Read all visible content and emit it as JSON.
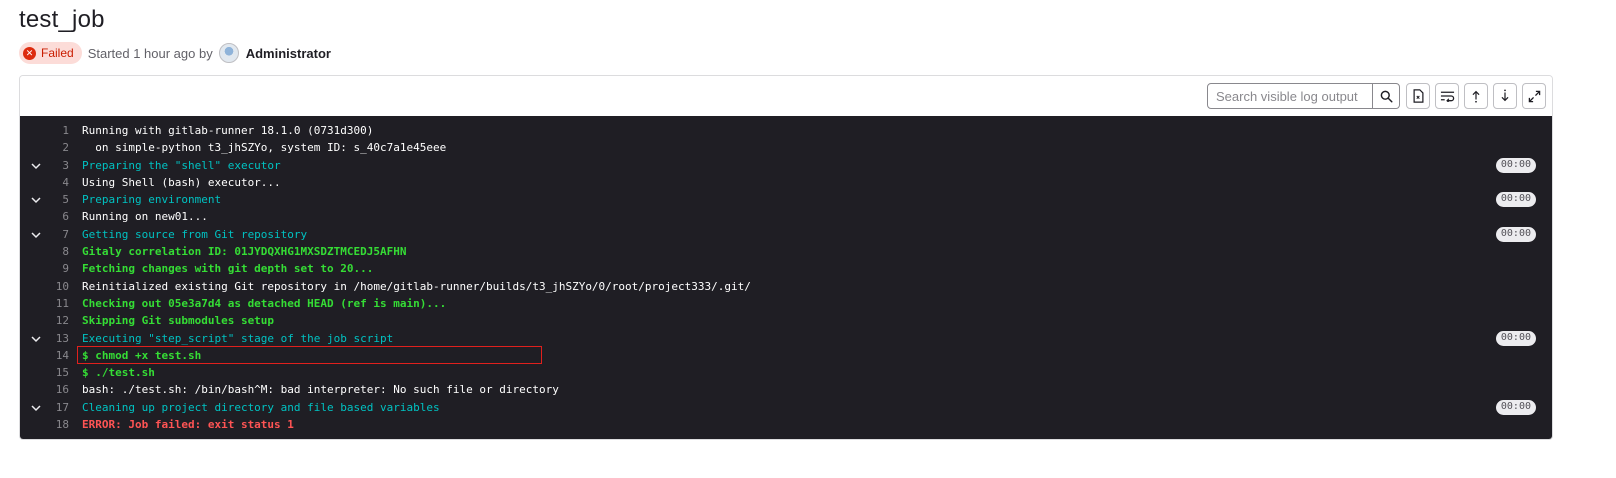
{
  "job": {
    "title": "test_job",
    "status": "Failed",
    "started": "Started 1 hour ago by",
    "user": "Administrator"
  },
  "toolbar": {
    "search_placeholder": "Search visible log output"
  },
  "icons": {
    "status": "x-circle-icon",
    "search": "search-icon",
    "raw": "file-icon",
    "wrap": "text-wrap-icon",
    "scroll_top": "scroll-up-icon",
    "scroll_bottom": "scroll-down-icon",
    "fullscreen": "maximize-icon"
  },
  "colors": {
    "failed_bg": "#fcdcd8",
    "failed_text": "#c91c00",
    "log_bg": "#1f1e24",
    "section": "#00c2c2",
    "success": "#35dd35",
    "error": "#ff5454",
    "highlight": "#e0201d"
  },
  "log": {
    "lines": [
      {
        "n": "1",
        "text": "Running with gitlab-runner 18.1.0 (0731d300)",
        "kind": "white",
        "section": false,
        "time": ""
      },
      {
        "n": "2",
        "text": "  on simple-python t3_jhSZYo, system ID: s_40c7a1e45eee",
        "kind": "white",
        "section": false,
        "time": ""
      },
      {
        "n": "3",
        "text": "Preparing the \"shell\" executor",
        "kind": "cyan",
        "section": true,
        "time": "00:00"
      },
      {
        "n": "4",
        "text": "Using Shell (bash) executor...",
        "kind": "white",
        "section": false,
        "time": ""
      },
      {
        "n": "5",
        "text": "Preparing environment",
        "kind": "cyan",
        "section": true,
        "time": "00:00"
      },
      {
        "n": "6",
        "text": "Running on new01...",
        "kind": "white",
        "section": false,
        "time": ""
      },
      {
        "n": "7",
        "text": "Getting source from Git repository",
        "kind": "cyan",
        "section": true,
        "time": "00:00"
      },
      {
        "n": "8",
        "text": "Gitaly correlation ID: 01JYDQXHG1MXSDZTMCEDJ5AFHN",
        "kind": "green",
        "section": false,
        "time": ""
      },
      {
        "n": "9",
        "text": "Fetching changes with git depth set to 20...",
        "kind": "green",
        "section": false,
        "time": ""
      },
      {
        "n": "10",
        "text": "Reinitialized existing Git repository in /home/gitlab-runner/builds/t3_jhSZYo/0/root/project333/.git/",
        "kind": "white",
        "section": false,
        "time": ""
      },
      {
        "n": "11",
        "text": "Checking out 05e3a7d4 as detached HEAD (ref is main)...",
        "kind": "green",
        "section": false,
        "time": ""
      },
      {
        "n": "12",
        "text": "Skipping Git submodules setup",
        "kind": "green",
        "section": false,
        "time": ""
      },
      {
        "n": "13",
        "text": "Executing \"step_script\" stage of the job script",
        "kind": "cyan",
        "section": true,
        "time": "00:00"
      },
      {
        "n": "14",
        "text": "$ chmod +x test.sh",
        "kind": "green",
        "section": false,
        "time": ""
      },
      {
        "n": "15",
        "text": "$ ./test.sh",
        "kind": "green",
        "section": false,
        "time": ""
      },
      {
        "n": "16",
        "text": "bash: ./test.sh: /bin/bash^M: bad interpreter: No such file or directory",
        "kind": "white",
        "section": false,
        "time": ""
      },
      {
        "n": "17",
        "text": "Cleaning up project directory and file based variables",
        "kind": "cyan",
        "section": true,
        "time": "00:00"
      },
      {
        "n": "18",
        "text": "ERROR: Job failed: exit status 1",
        "kind": "red",
        "section": false,
        "time": ""
      }
    ]
  }
}
